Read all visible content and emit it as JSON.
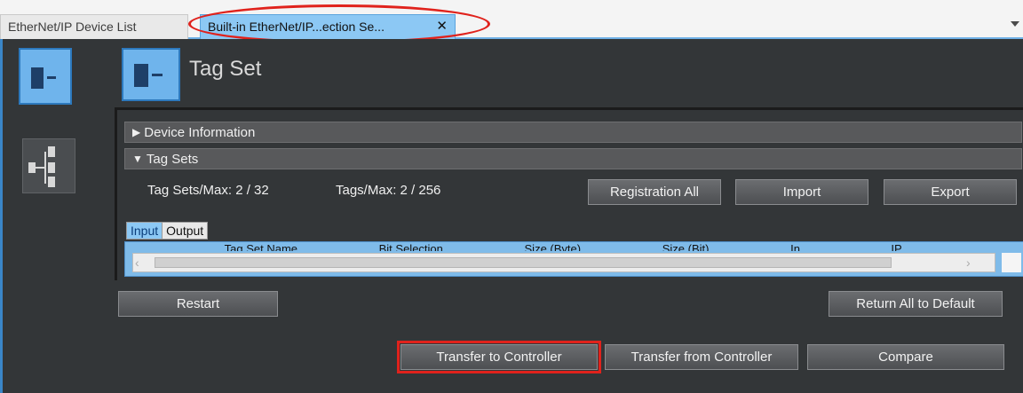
{
  "tabs": {
    "device_list": "EtherNet/IP Device List",
    "active": "Built-in EtherNet/IP...ection Se...",
    "close_glyph": "✕"
  },
  "header": {
    "title": "Tag Set"
  },
  "sections": {
    "device_information": "Device Information",
    "tag_sets": "Tag Sets"
  },
  "stats": {
    "tag_sets_max": "Tag Sets/Max:  2  /  32",
    "tags_max": "Tags/Max:  2  /  256"
  },
  "buttons": {
    "registration_all": "Registration All",
    "import": "Import",
    "export": "Export",
    "restart": "Restart",
    "return_all": "Return All to Default",
    "transfer_to": "Transfer to Controller",
    "transfer_from": "Transfer from Controller",
    "compare": "Compare"
  },
  "io_tabs": {
    "input": "Input",
    "output": "Output"
  },
  "grid": {
    "columns": [
      "",
      "Tag Set Name",
      "Bit Selection",
      "Size (Byte)",
      "Size (Bit)",
      "In...",
      "IP..."
    ]
  },
  "colors": {
    "accent_blue": "#8cc8f4",
    "panel_dark": "#333638",
    "highlight_red": "#e0221c"
  }
}
